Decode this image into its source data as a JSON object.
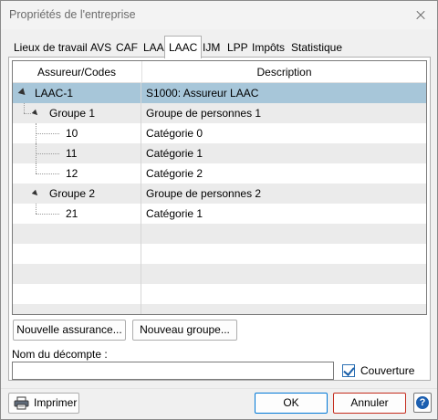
{
  "window": {
    "title": "Propriétés de l'entreprise"
  },
  "tabs": [
    {
      "label": "Lieux de travail"
    },
    {
      "label": "AVS"
    },
    {
      "label": "CAF"
    },
    {
      "label": "LAA"
    },
    {
      "label": "LAAC",
      "active": true
    },
    {
      "label": "IJM"
    },
    {
      "label": "LPP"
    },
    {
      "label": "Impôts"
    },
    {
      "label": "Statistique"
    }
  ],
  "tree": {
    "columns": [
      "Assureur/Codes",
      "Description"
    ],
    "rows": [
      {
        "code": "LAAC-1",
        "description": "S1000: Assureur LAAC"
      },
      {
        "code": "Groupe 1",
        "description": "Groupe de personnes 1"
      },
      {
        "code": "10",
        "description": "Catégorie 0"
      },
      {
        "code": "11",
        "description": "Catégorie 1"
      },
      {
        "code": "12",
        "description": "Catégorie 2"
      },
      {
        "code": "Groupe 2",
        "description": "Groupe de personnes 2"
      },
      {
        "code": "21",
        "description": "Catégorie 1"
      }
    ]
  },
  "actions": {
    "new_insurance": "Nouvelle assurance...",
    "new_group": "Nouveau groupe..."
  },
  "form": {
    "nom_label": "Nom du décompte :",
    "nom_value": "",
    "couverture_label": "Couverture",
    "couverture_checked": true
  },
  "footer": {
    "print": "Imprimer",
    "ok": "OK",
    "cancel": "Annuler",
    "help_glyph": "?"
  },
  "colors": {
    "selection": "#a7c6d9",
    "ok_border": "#0078d7",
    "cancel_border": "#c42b1c"
  }
}
